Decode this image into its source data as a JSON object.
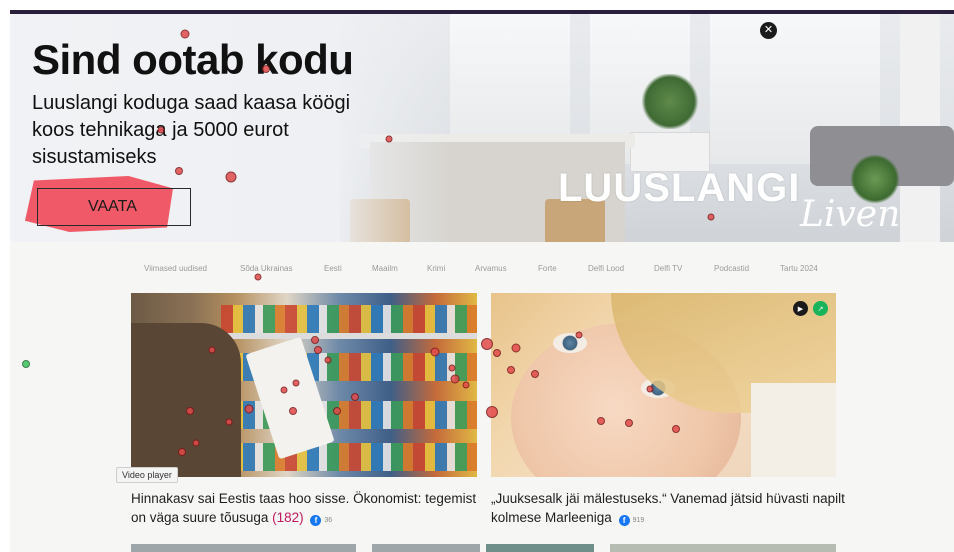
{
  "banner": {
    "headline": "Sind ootab kodu",
    "subtext": "Luuslangi koduga saad kaasa köögi koos tehnikaga ja 5000 eurot sisustamiseks",
    "cta_label": "VAATA",
    "logo_text": "LUUSLANGI",
    "logo_script": "Liven",
    "close_icon": "close-icon",
    "accent_color": "#f05a68"
  },
  "nav": {
    "items": [
      "Viimased uudised",
      "Sõda Ukrainas",
      "Eesti",
      "Maailm",
      "Krimi",
      "Arvamus",
      "Forte",
      "Delfi Lood",
      "Delfi TV",
      "Podcastid",
      "Tartu 2024"
    ]
  },
  "tooltip": "Video player",
  "articles": [
    {
      "title": "Hinnakasv sai Eestis taas hoo sisse. Ökonomist: tegemist on väga suure tõusuga",
      "comments": "(182)",
      "fb_count": "36"
    },
    {
      "title": "„Juuksesalk jäi mälestuseks.“ Vanemad jätsid hüvasti napilt kolmese Marleeniga",
      "comments": "",
      "fb_count": "919"
    }
  ],
  "icons": {
    "play": "play-icon",
    "trending": "trending-icon",
    "facebook": "facebook-icon"
  },
  "colors": {
    "topbar": "#2a1f3d",
    "comment_count": "#c2185b",
    "facebook": "#1877f2"
  }
}
